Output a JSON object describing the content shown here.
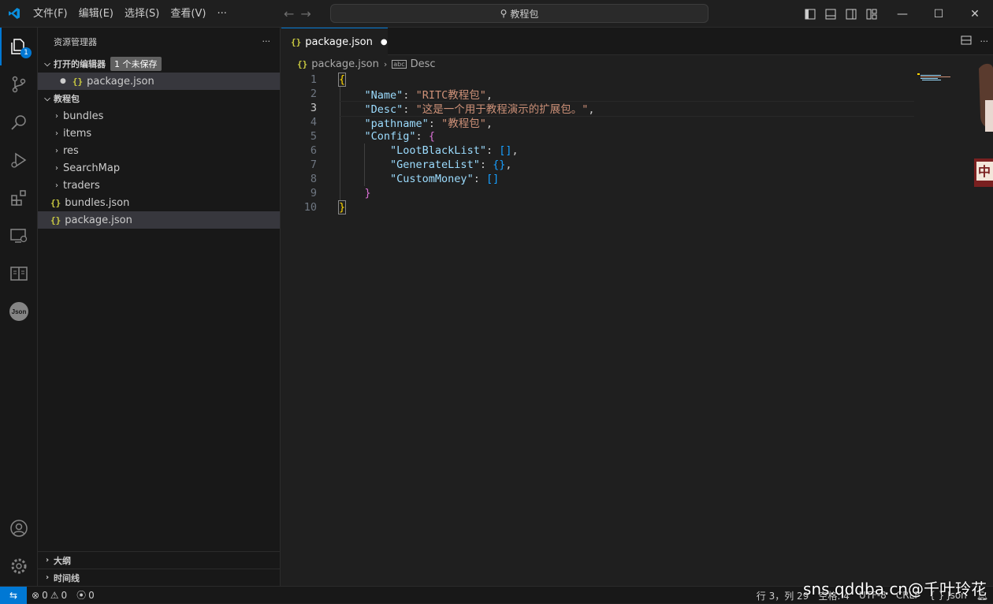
{
  "menu": [
    "文件(F)",
    "编辑(E)",
    "选择(S)",
    "查看(V)",
    "···"
  ],
  "search": {
    "text": "教程包"
  },
  "activity": {
    "explorer_badge": "1"
  },
  "sidebar": {
    "title": "资源管理器",
    "more": "···",
    "open_editors": {
      "label": "打开的编辑器",
      "unsaved": "1 个未保存",
      "items": [
        "package.json"
      ]
    },
    "folder": {
      "label": "教程包",
      "folders": [
        "bundles",
        "items",
        "res",
        "SearchMap",
        "traders"
      ],
      "files": [
        "bundles.json",
        "package.json"
      ]
    },
    "outline": "大纲",
    "timeline": "时间线"
  },
  "tab": {
    "label": "package.json",
    "dirty": "●"
  },
  "breadcrumb": {
    "file": "package.json",
    "symbol": "Desc"
  },
  "code": {
    "line_numbers": [
      "1",
      "2",
      "3",
      "4",
      "5",
      "6",
      "7",
      "8",
      "9",
      "10"
    ],
    "current_line": "3",
    "pairs": {
      "name_key": "\"Name\"",
      "name_val": "\"RITC教程包\"",
      "desc_key": "\"Desc\"",
      "desc_val": "\"这是一个用于教程演示的扩展包。\"",
      "path_key": "\"pathname\"",
      "path_val": "\"教程包\"",
      "config_key": "\"Config\"",
      "loot_key": "\"LootBlackList\"",
      "gen_key": "\"GenerateList\"",
      "money_key": "\"CustomMoney\""
    }
  },
  "status": {
    "errors": "0",
    "warnings": "0",
    "ports": "0",
    "position": "行 3，列 29",
    "spaces": "空格: 4",
    "encoding": "UTF-8",
    "eol": "CRLF",
    "language": "{ } Json"
  },
  "watermark": "sns.qddba.cn@千叶玲花",
  "colors": {
    "accent": "#0078d4",
    "json_icon": "#cbcb41",
    "key": "#9cdcfe",
    "string": "#ce9178"
  }
}
